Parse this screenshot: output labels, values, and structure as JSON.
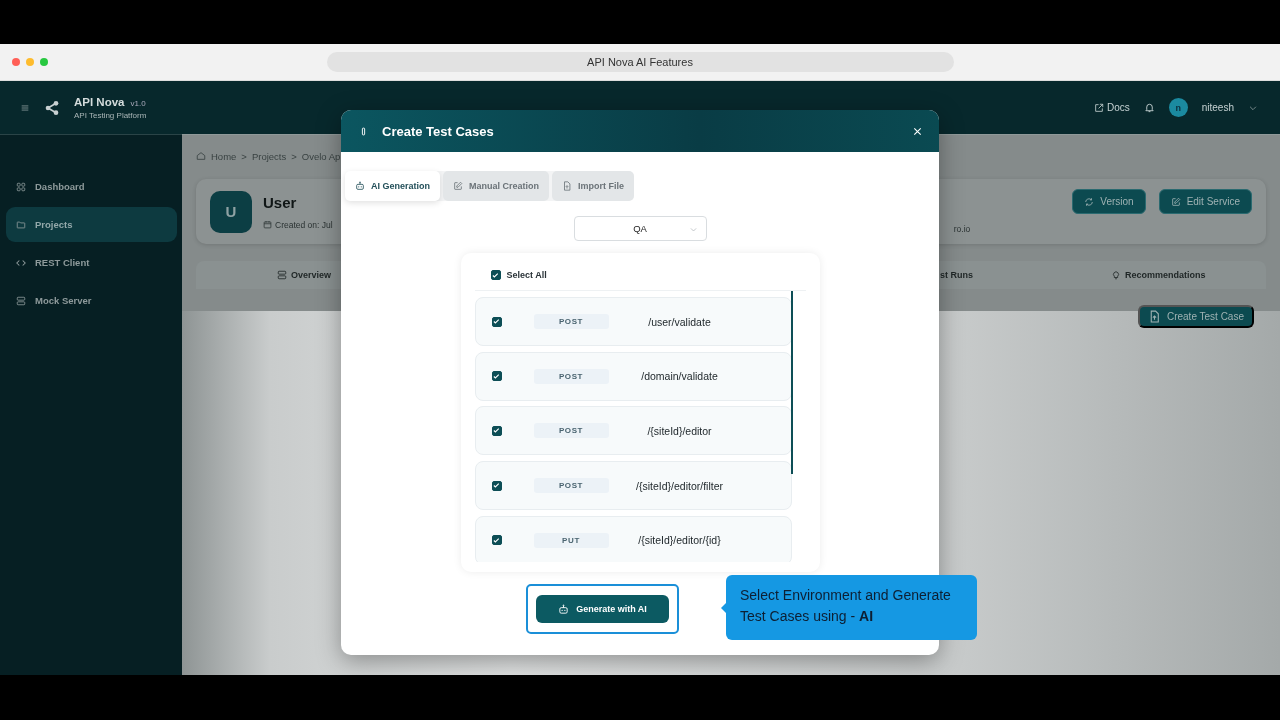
{
  "browser": {
    "title": "API Nova AI Features"
  },
  "header": {
    "app_name": "API Nova",
    "version": "v1.0",
    "subtitle": "API Testing Platform",
    "docs": "Docs",
    "avatar": "n",
    "user": "niteesh"
  },
  "sidebar": {
    "items": [
      {
        "label": "Dashboard",
        "selected": false
      },
      {
        "label": "Projects",
        "selected": true
      },
      {
        "label": "REST Client",
        "selected": false
      },
      {
        "label": "Mock Server",
        "selected": false
      }
    ]
  },
  "breadcrumb": {
    "items": [
      "Home",
      "Projects",
      "Ovelo Ap"
    ],
    "separator": ">"
  },
  "service": {
    "avatar": "U",
    "name": "User",
    "created": "Created on: Jul",
    "url": "ro.io",
    "buttons": [
      "Version",
      "Edit Service"
    ]
  },
  "tabs": [
    {
      "label": "Overview"
    },
    {
      "label": "st Runs"
    },
    {
      "label": "Recommendations"
    }
  ],
  "create_button": "Create Test Case",
  "modal": {
    "title": "Create Test Cases",
    "tabs": [
      {
        "label": "AI Generation",
        "selected": true
      },
      {
        "label": "Manual Creation",
        "selected": false
      },
      {
        "label": "Import File",
        "selected": false
      }
    ],
    "environment": "QA",
    "select_all": {
      "label": "Select All",
      "checked": true
    },
    "endpoints": [
      {
        "method": "POST",
        "path": "/user/validate",
        "checked": true
      },
      {
        "method": "POST",
        "path": "/domain/validate",
        "checked": true
      },
      {
        "method": "POST",
        "path": "/{siteId}/editor",
        "checked": true
      },
      {
        "method": "POST",
        "path": "/{siteId}/editor/filter",
        "checked": true
      },
      {
        "method": "PUT",
        "path": "/{siteId}/editor/{id}",
        "checked": true
      }
    ],
    "generate_button": "Generate with AI"
  },
  "tooltip": "Select Environment and Generate Test Cases using - **AI**"
}
